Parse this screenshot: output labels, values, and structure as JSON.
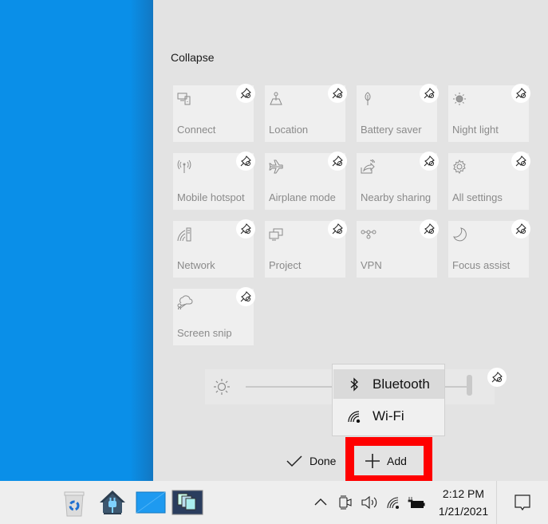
{
  "panel": {
    "collapse_label": "Collapse",
    "tiles": [
      {
        "label": "Connect",
        "icon": "connect-icon"
      },
      {
        "label": "Location",
        "icon": "location-icon"
      },
      {
        "label": "Battery saver",
        "icon": "battery-saver-icon"
      },
      {
        "label": "Night light",
        "icon": "night-light-icon"
      },
      {
        "label": "Mobile hotspot",
        "icon": "mobile-hotspot-icon"
      },
      {
        "label": "Airplane mode",
        "icon": "airplane-icon"
      },
      {
        "label": "Nearby sharing",
        "icon": "nearby-sharing-icon"
      },
      {
        "label": "All settings",
        "icon": "gear-icon"
      },
      {
        "label": "Network",
        "icon": "network-icon"
      },
      {
        "label": "Project",
        "icon": "project-icon"
      },
      {
        "label": "VPN",
        "icon": "vpn-icon"
      },
      {
        "label": "Focus assist",
        "icon": "moon-icon"
      },
      {
        "label": "Screen snip",
        "icon": "screen-snip-icon"
      }
    ],
    "brightness": {
      "icon": "sun-icon",
      "level": 0.95
    },
    "add_menu": {
      "items": [
        {
          "label": "Bluetooth",
          "icon": "bluetooth-icon",
          "highlighted": true
        },
        {
          "label": "Wi-Fi",
          "icon": "wifi-icon",
          "highlighted": false
        }
      ]
    },
    "done_label": "Done",
    "add_label": "Add",
    "highlight_color": "#ff0000"
  },
  "taskbar": {
    "pinned": [
      "recycle-bin-icon",
      "home-plug-icon",
      "blue-window-icon",
      "remote-desktop-icon"
    ],
    "tray": [
      "chevron-up-icon",
      "camera-icon",
      "volume-icon",
      "wifi-icon",
      "battery-icon"
    ],
    "time": "2:12 PM",
    "date": "1/21/2021",
    "notification_icon": "action-center-icon"
  },
  "colors": {
    "desktop": "#0a8fe8",
    "panel": "#e3e3e3",
    "tile": "#efefef",
    "accent_red": "#ff0000"
  }
}
